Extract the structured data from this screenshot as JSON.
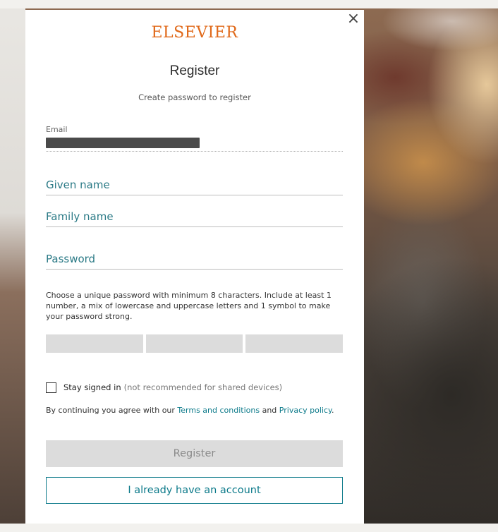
{
  "brand": {
    "logo_text": "ELSEVIER"
  },
  "dialog": {
    "close_glyph": "×",
    "title": "Register",
    "subtitle": "Create password to register"
  },
  "email": {
    "label": "Email",
    "value": ""
  },
  "fields": {
    "given_name_placeholder": "Given name",
    "family_name_placeholder": "Family name",
    "password_placeholder": "Password"
  },
  "password_hint": "Choose a unique password with minimum 8 characters. Include at least 1 number, a mix of lowercase and uppercase letters and 1 symbol to make your password strong.",
  "stay_signed_in": {
    "label": "Stay signed in",
    "note": "(not recommended for shared devices)"
  },
  "terms": {
    "prefix": "By continuing you agree with our ",
    "terms_link": "Terms and conditions",
    "middle": " and ",
    "privacy_link": "Privacy policy",
    "suffix": "."
  },
  "buttons": {
    "register": "Register",
    "already_have_account": "I already have an account"
  },
  "colors": {
    "brand_orange": "#e0691a",
    "accent_teal": "#0c7a8a",
    "disabled_gray": "#dcdcdc"
  }
}
